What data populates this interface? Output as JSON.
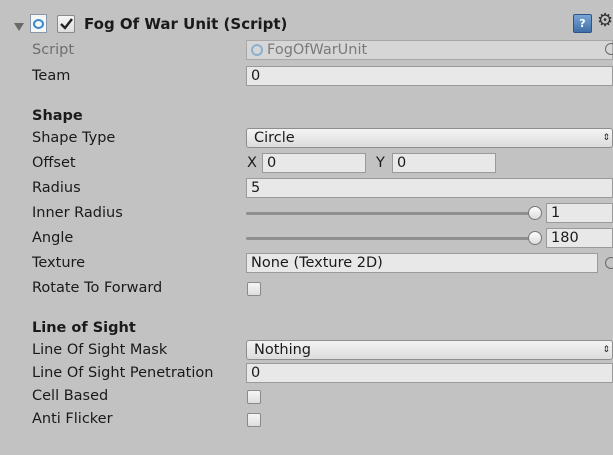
{
  "component": {
    "title": "Fog Of War Unit (Script)",
    "enabled": true,
    "script_label": "Script",
    "script_value": "FogOfWarUnit"
  },
  "fields": {
    "team": {
      "label": "Team",
      "value": "0"
    },
    "shape_section": "Shape",
    "shape_type": {
      "label": "Shape Type",
      "value": "Circle"
    },
    "offset": {
      "label": "Offset",
      "x_label": "X",
      "x_value": "0",
      "y_label": "Y",
      "y_value": "0"
    },
    "radius": {
      "label": "Radius",
      "value": "5"
    },
    "inner_radius": {
      "label": "Inner Radius",
      "value": "1"
    },
    "angle": {
      "label": "Angle",
      "value": "180"
    },
    "texture": {
      "label": "Texture",
      "value": "None (Texture 2D)"
    },
    "rotate_to_forward": {
      "label": "Rotate To Forward",
      "checked": false
    },
    "los_section": "Line of Sight",
    "line_of_sight_mask": {
      "label": "Line Of Sight Mask",
      "value": "Nothing"
    },
    "line_of_sight_penetration": {
      "label": "Line Of Sight Penetration",
      "value": "0"
    },
    "cell_based": {
      "label": "Cell Based",
      "checked": false
    },
    "anti_flicker": {
      "label": "Anti Flicker",
      "checked": false
    }
  },
  "icons": {
    "foldout": "triangle-down-icon",
    "script_component": "script-icon",
    "help": "help-book-icon",
    "settings": "gear-icon",
    "object_picker": "object-picker-icon",
    "popup_arrows": "up-down-arrows-icon"
  }
}
